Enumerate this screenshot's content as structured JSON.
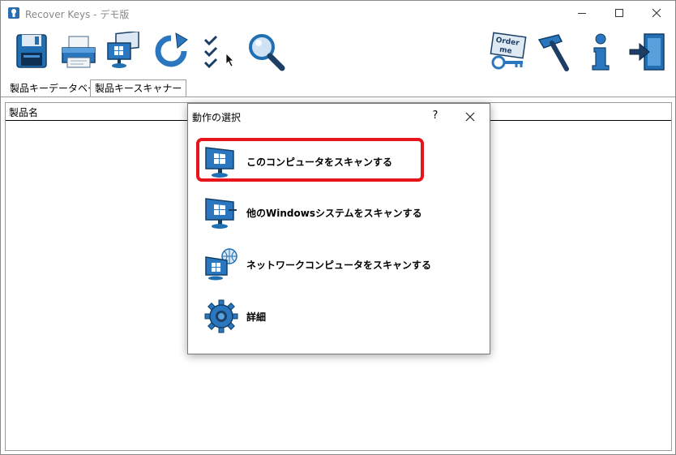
{
  "window": {
    "title": "Recover Keys - デモ版"
  },
  "titlebar_icons": [
    "app-keyhole-icon",
    "minimize-icon",
    "maximize-icon",
    "close-icon"
  ],
  "toolbar": {
    "icons": [
      "save-disk-icon",
      "printer-icon",
      "network-computers-icon",
      "refresh-icon",
      "checklist-icon",
      "magnifier-icon",
      "order-me-key-icon",
      "hammer-icon",
      "info-icon",
      "exit-door-icon"
    ],
    "order_text": "Order me"
  },
  "tabs": [
    {
      "label": "製品キーデータベース",
      "active": false
    },
    {
      "label": "製品キースキャナー",
      "active": true
    }
  ],
  "list": {
    "column_header": "製品名"
  },
  "dialog": {
    "title": "動作の選択",
    "help_label": "?",
    "options": [
      {
        "label": "このコンピュータをスキャンする",
        "icon": "computer-icon",
        "highlighted": true
      },
      {
        "label": "他のWindowsシステムをスキャンする",
        "icon": "other-windows-icon"
      },
      {
        "label": "ネットワークコンピュータをスキャンする",
        "icon": "network-computer-icon"
      },
      {
        "label": "詳細",
        "icon": "gear-icon"
      }
    ],
    "highlight_color": "#e8141c"
  },
  "colors": {
    "icon_blue": "#1f6fb2",
    "icon_dark": "#1d3f66"
  }
}
